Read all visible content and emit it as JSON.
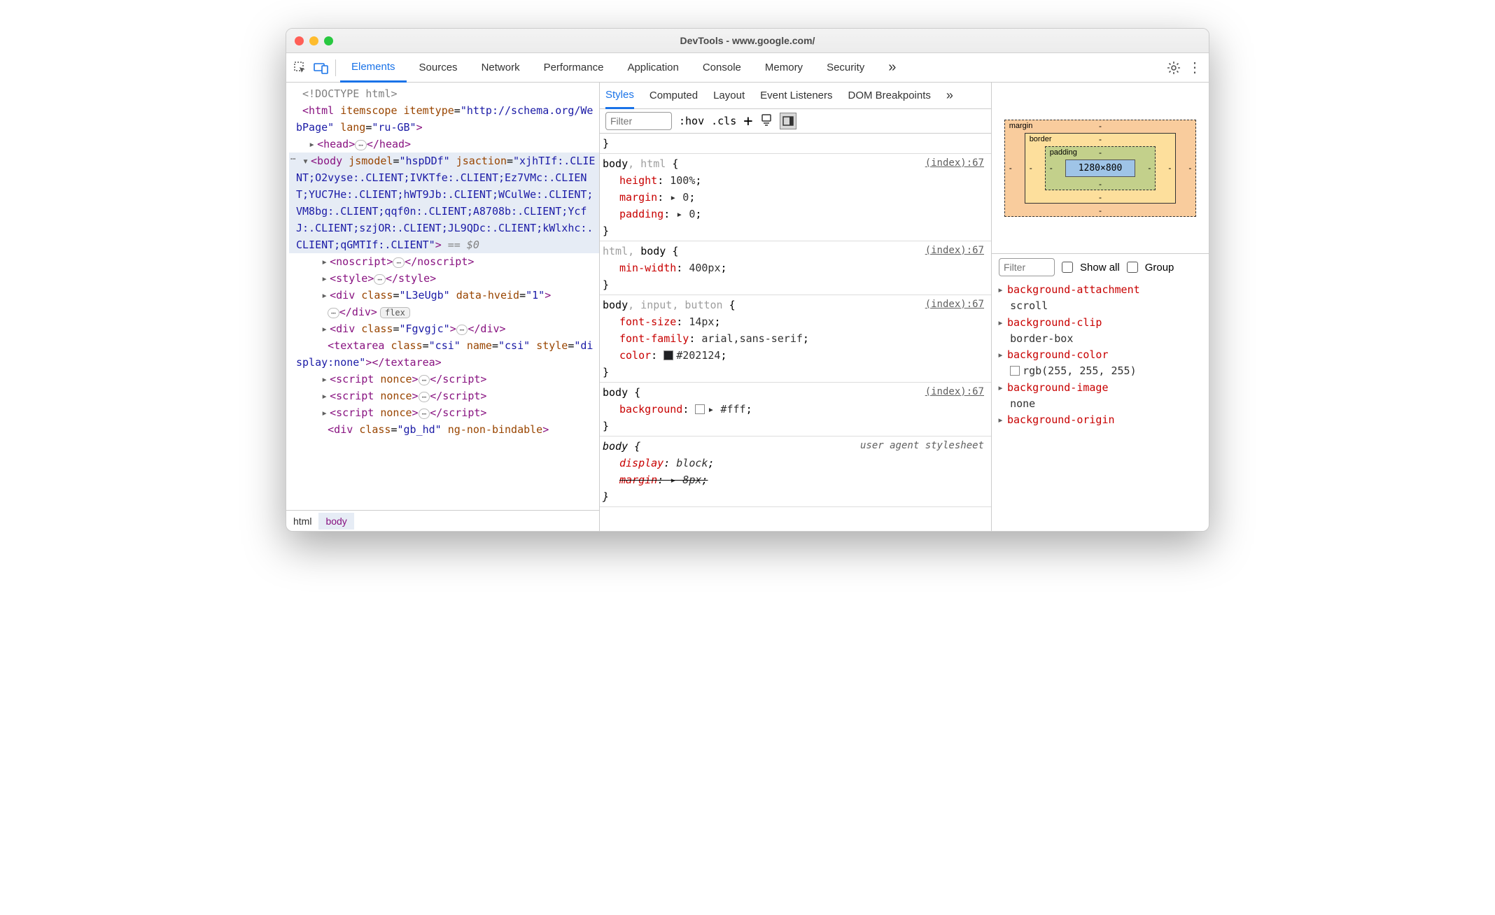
{
  "window": {
    "title": "DevTools - www.google.com/"
  },
  "mainTabs": {
    "items": [
      "Elements",
      "Sources",
      "Network",
      "Performance",
      "Application",
      "Console",
      "Memory",
      "Security"
    ],
    "active": "Elements",
    "moreGlyph": "»"
  },
  "dom": {
    "doctype": "<!DOCTYPE html>",
    "htmlOpen": {
      "tag": "html",
      "attrs": "itemscope itemtype=\"http://schema.org/WebPage\" lang=\"ru-GB\"",
      "attrsName": "itemscope itemtype",
      "itemtypeVal": "http://schema.org/WebPage",
      "langVal": "ru-GB"
    },
    "head": "head",
    "body": {
      "tag": "body",
      "attr1": "jsmodel",
      "val1": "hspDDf",
      "attr2": "jsaction",
      "val2": "xjhTIf:.CLIENT;O2vyse:.CLIENT;IVKTfe:.CLIENT;Ez7VMc:.CLIENT;YUC7He:.CLIENT;hWT9Jb:.CLIENT;WCulWe:.CLIENT;VM8bg:.CLIENT;qqf0n:.CLIENT;A8708b:.CLIENT;YcfJ:.CLIENT;szjOR:.CLIENT;JL9QDc:.CLIENT;kWlxhc:.CLIENT;qGMTIf:.CLIENT",
      "after": "== $0"
    },
    "children": {
      "noscript": "noscript",
      "style": "style",
      "div1": {
        "tag": "div",
        "cls": "L3eUgb",
        "extra": "data-hveid",
        "extraVal": "1",
        "badge": "flex"
      },
      "div2": {
        "tag": "div",
        "cls": "Fgvgjc"
      },
      "textarea": {
        "tag": "textarea",
        "cls": "csi",
        "name": "csi",
        "style": "display:none"
      },
      "script": "script nonce",
      "div3": {
        "tag": "div",
        "cls": "gb_hd",
        "extra": "ng-non-bindable"
      }
    },
    "crumbs": [
      "html",
      "body"
    ]
  },
  "subTabs": {
    "items": [
      "Styles",
      "Computed",
      "Layout",
      "Event Listeners",
      "DOM Breakpoints"
    ],
    "active": "Styles",
    "more": "»"
  },
  "stylesToolbar": {
    "filterPlaceholder": "Filter",
    "hov": ":hov",
    "cls": ".cls"
  },
  "rules": [
    {
      "brace_only_close": true
    },
    {
      "selector_html": "body<g>, html</g>",
      "src": "(index):67",
      "decls": [
        {
          "p": "height",
          "v": "100%"
        },
        {
          "p": "margin",
          "v": "▸ 0"
        },
        {
          "p": "padding",
          "v": "▸ 0"
        }
      ]
    },
    {
      "selector_html": "<g>html, </g>body",
      "src": "(index):67",
      "decls": [
        {
          "p": "min-width",
          "v": "400px"
        }
      ]
    },
    {
      "selector_html": "body<g>, input, button</g>",
      "src": "(index):67",
      "decls": [
        {
          "p": "font-size",
          "v": "14px"
        },
        {
          "p": "font-family",
          "v": "arial,sans-serif"
        },
        {
          "p": "color",
          "v": "#202124",
          "swatch": "#202124"
        }
      ]
    },
    {
      "selector_html": "body",
      "src": "(index):67",
      "decls": [
        {
          "p": "background",
          "v": "▸ #fff",
          "swatch": "#ffffff",
          "swatchBorder": true
        }
      ]
    },
    {
      "selector_html": "body",
      "src": "user agent stylesheet",
      "ua": true,
      "decls": [
        {
          "p": "display",
          "v": "block",
          "ital": true
        },
        {
          "p": "margin",
          "v": "▸ 8px",
          "ital": true,
          "strike": true
        }
      ]
    }
  ],
  "boxmodel": {
    "margin": "margin",
    "border": "border",
    "padding": "padding",
    "content": "1280×800",
    "dash": "-"
  },
  "computedToolbar": {
    "filter": "Filter",
    "showAll": "Show all",
    "group": "Group"
  },
  "computed": [
    {
      "n": "background-attachment",
      "v": "scroll"
    },
    {
      "n": "background-clip",
      "v": "border-box"
    },
    {
      "n": "background-color",
      "v": "rgb(255, 255, 255)",
      "swatch": "#ffffff"
    },
    {
      "n": "background-image",
      "v": "none"
    },
    {
      "n": "background-origin",
      "v": ""
    }
  ]
}
